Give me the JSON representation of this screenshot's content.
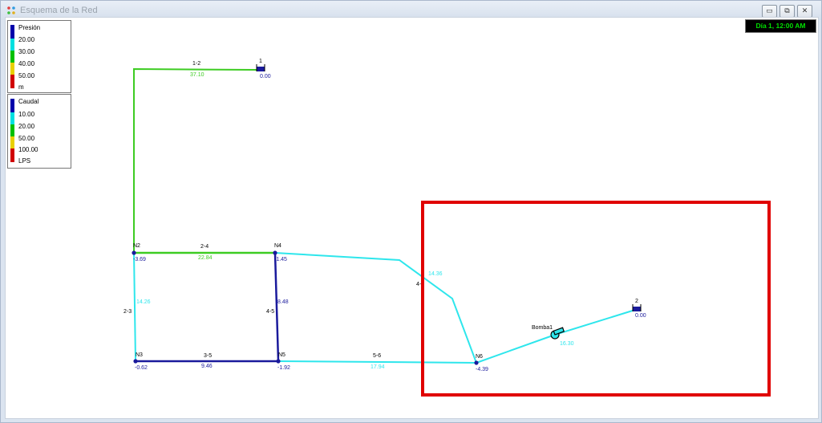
{
  "window": {
    "title": "Esquema de la Red",
    "controls": {
      "minimize": "▭",
      "restore": "⧉",
      "close": "✕"
    }
  },
  "time_display": "Día 1, 12:00 AM",
  "legend_pressure": {
    "title": "Presión",
    "values": [
      "20.00",
      "30.00",
      "40.00",
      "50.00"
    ],
    "unit": "m",
    "colors": [
      "#0000aa",
      "#00e0e0",
      "#00c000",
      "#e8d000",
      "#d00000"
    ]
  },
  "legend_flow": {
    "title": "Caudal",
    "values": [
      "10.00",
      "20.00",
      "50.00",
      "100.00"
    ],
    "unit": "LPS",
    "colors": [
      "#0000aa",
      "#00e0e0",
      "#00c000",
      "#e8d000",
      "#d00000"
    ]
  },
  "network": {
    "nodes": {
      "n2": {
        "label": "N2",
        "value": "-3.69"
      },
      "n3": {
        "label": "N3",
        "value": "-0.62"
      },
      "n4": {
        "label": "N4",
        "value": "-1.45"
      },
      "n5": {
        "label": "N5",
        "value": "-1.92"
      },
      "n6": {
        "label": "N6",
        "value": "-4.39"
      },
      "tank1": {
        "label": "1",
        "value": "0.00"
      },
      "tank2": {
        "label": "2",
        "value": "0.00"
      }
    },
    "links": {
      "l12": {
        "label": "1-2",
        "value": "37.10"
      },
      "l24": {
        "label": "2-4",
        "value": "22.84"
      },
      "l23": {
        "label": "2-3",
        "value": "14.26"
      },
      "l45": {
        "label": "4-5",
        "value": "8.48"
      },
      "l35": {
        "label": "3-5",
        "value": "9.46"
      },
      "l56": {
        "label": "5-6",
        "value": "17.94"
      },
      "l46": {
        "label": "4-",
        "value": "14.36"
      },
      "pump": {
        "label": "Bomba1",
        "value": "16.30"
      }
    },
    "colors": {
      "green": "#3dcc22",
      "cyan": "#2ee6ec",
      "blue": "#1a1a9c",
      "highlight": "#e00000"
    }
  }
}
